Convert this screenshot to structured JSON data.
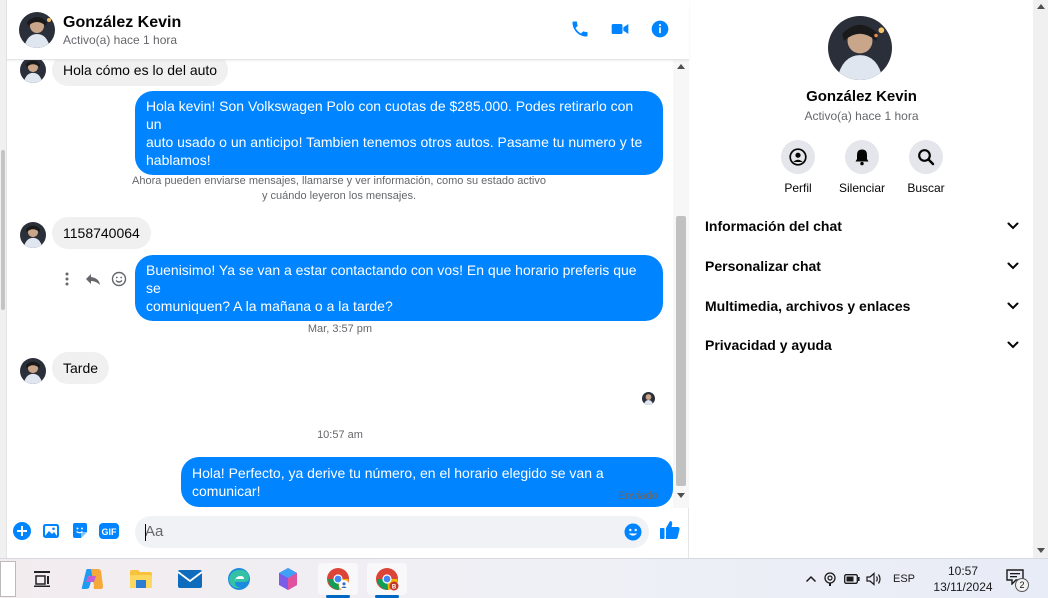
{
  "header": {
    "name": "González Kevin",
    "status": "Activo(a) hace 1 hora",
    "icons": [
      "phone-icon",
      "video-camera-icon",
      "info-icon"
    ]
  },
  "messages": [
    {
      "direction": "in",
      "text": "Hola cómo es lo del auto"
    },
    {
      "direction": "out",
      "lines": [
        "Hola kevin!  Son Volkswagen Polo con cuotas de $285.000. Podes retirarlo con un",
        "auto usado o un anticipo! Tambien tenemos otros autos. Pasame tu numero y te",
        "hablamos!"
      ]
    },
    {
      "direction": "system",
      "lines": [
        "Ahora pueden enviarse mensajes, llamarse y ver información, como su estado activo",
        "y cuándo leyeron los mensajes."
      ]
    },
    {
      "direction": "in",
      "text": "1158740064"
    },
    {
      "direction": "out",
      "lines": [
        "Buenisimo! Ya se van a estar contactando con vos! En que horario preferis que se",
        "comuniquen? A la mañana o a la tarde?"
      ]
    },
    {
      "direction": "time",
      "text": "Mar, 3:57 pm"
    },
    {
      "direction": "in",
      "text": "Tarde"
    },
    {
      "direction": "time",
      "text": "10:57 am"
    },
    {
      "direction": "out",
      "text": "Hola! Perfecto, ya derive tu número, en el horario elegido se van a comunicar!"
    }
  ],
  "sent_label": "Enviado",
  "composer": {
    "placeholder": "Aa",
    "tools": [
      "plus-circle-icon",
      "image-icon",
      "sticker-icon",
      "gif-icon"
    ],
    "gif_label": "GIF"
  },
  "info_panel": {
    "name": "González Kevin",
    "status": "Activo(a) hace 1 hora",
    "actions": [
      {
        "label": "Perfil",
        "icon": "profile-icon"
      },
      {
        "label": "Silenciar",
        "icon": "bell-icon"
      },
      {
        "label": "Buscar",
        "icon": "search-icon"
      }
    ],
    "sections": [
      "Información del chat",
      "Personalizar chat",
      "Multimedia, archivos y enlaces",
      "Privacidad y ayuda"
    ]
  },
  "taskbar": {
    "apps": [
      "task-view-icon",
      "copilot-icon",
      "file-explorer-icon",
      "mail-icon",
      "edge-icon",
      "microsoft365-icon",
      "chrome-profile-icon",
      "chrome-icon"
    ],
    "language": "ESP",
    "time": "10:57",
    "date": "13/11/2024",
    "notification_count": "2"
  },
  "colors": {
    "accent": "#0084ff",
    "bubble_in": "#f0f0f0",
    "muted_text": "#65676b"
  }
}
